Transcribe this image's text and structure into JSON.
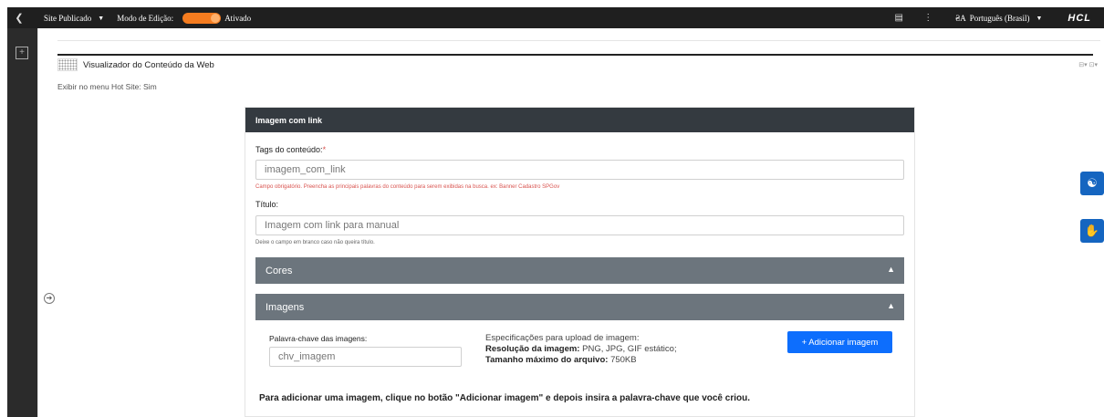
{
  "topbar": {
    "back_icon": "chevron-left-icon",
    "site_status": "Site Publicado",
    "edit_mode_label": "Modo de Edição:",
    "edit_mode_state": "Ativado",
    "edit_mode_on": true,
    "toggle_color": "#f57c1f",
    "page_icon": "page-icon",
    "more_icon": "vertical-dots-icon",
    "language_icon": "translate-icon",
    "language": "Português (Brasil)",
    "logo": "HCL"
  },
  "leftrail": {
    "add_icon": "add-panel-icon",
    "expand_icon": "arrow-right-circle-icon"
  },
  "portlet": {
    "title": "Visualizador do Conteúdo da Web",
    "tools": "⊟▾ ⊡▾",
    "hotsite_line": "Exibir no menu Hot Site: Sim"
  },
  "form": {
    "header": "Imagem com link",
    "tags_label": "Tags do conteúdo:",
    "tags_required_mark": "*",
    "tags_value": "imagem_com_link",
    "tags_hint": "Campo obrigatório. Preencha as principais palavras do conteúdo para serem exibidas na busca. ex: Banner Cadastro SPGov",
    "title_label": "Título:",
    "title_value": "Imagem com link para manual",
    "title_hint": "Deixe o campo em branco caso não queira título.",
    "section_colors": "Cores",
    "section_images": "Imagens",
    "section_header_color": "#6c757d",
    "keyword_label": "Palavra-chave das imagens:",
    "keyword_value": "chv_imagem",
    "spec_title": "Especificações para upload de imagem:",
    "spec_resolution_label": "Resolução da imagem:",
    "spec_resolution_value": "PNG, JPG, GIF estático;",
    "spec_size_label": "Tamanho máximo do arquivo:",
    "spec_size_value": "750KB",
    "add_button": "+ Adicionar imagem",
    "add_button_color": "#0d6efd",
    "instruction": "Para adicionar uma imagem, clique no botão \"Adicionar imagem\" e depois insira a palavra-chave que você criou."
  },
  "accessibility": {
    "access_icon": "accessibility-icon",
    "sign_language_icon": "sign-language-icon",
    "color": "#1565c0"
  }
}
